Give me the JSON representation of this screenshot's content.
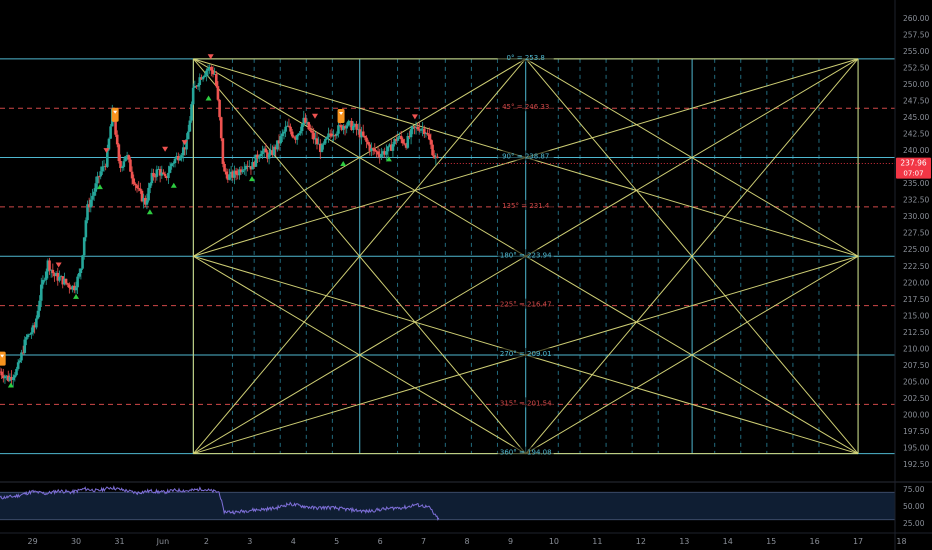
{
  "chart_data": {
    "type": "candlestick",
    "price_axis": {
      "range": [
        190.4,
        262.7
      ],
      "ticks": [
        "260.00",
        "257.50",
        "255.00",
        "252.50",
        "250.00",
        "247.50",
        "245.00",
        "242.50",
        "240.00",
        "237.50",
        "235.00",
        "232.50",
        "230.00",
        "227.50",
        "225.00",
        "222.50",
        "220.00",
        "217.50",
        "215.00",
        "212.50",
        "210.00",
        "207.50",
        "205.00",
        "202.50",
        "200.00",
        "197.50",
        "195.00",
        "192.50"
      ],
      "last_price": "237.96",
      "countdown": "07:07"
    },
    "time_axis": {
      "range": [
        28.15,
        18.75
      ],
      "labels": [
        {
          "t": 28.9,
          "label": "29"
        },
        {
          "t": 29.9,
          "label": "30"
        },
        {
          "t": 30.9,
          "label": "31"
        },
        {
          "t": 31.9,
          "label": "Jun"
        },
        {
          "t": 32.9,
          "label": "2"
        },
        {
          "t": 33.9,
          "label": "3"
        },
        {
          "t": 34.9,
          "label": "4"
        },
        {
          "t": 35.9,
          "label": "5"
        },
        {
          "t": 36.9,
          "label": "6"
        },
        {
          "t": 37.9,
          "label": "7"
        },
        {
          "t": 38.9,
          "label": "8"
        },
        {
          "t": 39.9,
          "label": "9"
        },
        {
          "t": 40.9,
          "label": "10"
        },
        {
          "t": 41.9,
          "label": "11"
        },
        {
          "t": 42.9,
          "label": "12"
        },
        {
          "t": 43.9,
          "label": "13"
        },
        {
          "t": 44.9,
          "label": "14"
        },
        {
          "t": 45.9,
          "label": "15"
        },
        {
          "t": 46.9,
          "label": "16"
        },
        {
          "t": 47.9,
          "label": "17"
        },
        {
          "t": 48.9,
          "label": "18"
        }
      ]
    },
    "price_path": [
      [
        28.15,
        206.5
      ],
      [
        28.35,
        205.4
      ],
      [
        28.55,
        206.8
      ],
      [
        28.75,
        211.5
      ],
      [
        28.95,
        213.2
      ],
      [
        29.1,
        219.0
      ],
      [
        29.25,
        223.0
      ],
      [
        29.4,
        221.0
      ],
      [
        29.55,
        220.5
      ],
      [
        29.7,
        219.7
      ],
      [
        29.85,
        219.2
      ],
      [
        30.0,
        221.5
      ],
      [
        30.15,
        231.0
      ],
      [
        30.3,
        233.5
      ],
      [
        30.45,
        236.5
      ],
      [
        30.6,
        238.3
      ],
      [
        30.75,
        246.5
      ],
      [
        30.9,
        237.0
      ],
      [
        31.05,
        239.5
      ],
      [
        31.2,
        236.0
      ],
      [
        31.35,
        233.5
      ],
      [
        31.5,
        232.0
      ],
      [
        31.65,
        236.0
      ],
      [
        31.8,
        237.0
      ],
      [
        31.95,
        235.5
      ],
      [
        32.1,
        238.0
      ],
      [
        32.3,
        239.5
      ],
      [
        32.45,
        241.0
      ],
      [
        32.6,
        249.0
      ],
      [
        32.75,
        251.0
      ],
      [
        32.95,
        252.5
      ],
      [
        33.1,
        251.5
      ],
      [
        33.2,
        245.0
      ],
      [
        33.3,
        236.5
      ],
      [
        33.45,
        236.0
      ],
      [
        33.6,
        236.5
      ],
      [
        33.8,
        238.0
      ],
      [
        33.95,
        237.5
      ],
      [
        34.15,
        240.0
      ],
      [
        34.35,
        239.0
      ],
      [
        34.55,
        241.0
      ],
      [
        34.75,
        243.5
      ],
      [
        34.95,
        242.0
      ],
      [
        35.15,
        244.5
      ],
      [
        35.35,
        242.0
      ],
      [
        35.55,
        240.0
      ],
      [
        35.75,
        242.5
      ],
      [
        35.9,
        243.0
      ],
      [
        36.1,
        244.0
      ],
      [
        36.3,
        243.5
      ],
      [
        36.5,
        242.0
      ],
      [
        36.7,
        240.0
      ],
      [
        36.9,
        239.5
      ],
      [
        37.1,
        240.0
      ],
      [
        37.3,
        242.0
      ],
      [
        37.5,
        241.0
      ],
      [
        37.65,
        243.0
      ],
      [
        37.8,
        243.5
      ],
      [
        37.95,
        243.0
      ],
      [
        38.05,
        241.0
      ],
      [
        38.15,
        239.0
      ],
      [
        38.25,
        237.96
      ]
    ],
    "gann_box": {
      "t_start": 32.6,
      "t_end": 47.9,
      "price_top": 253.8,
      "price_bottom": 194.08,
      "levels": [
        {
          "label": "0° = 253.8",
          "price": 253.8,
          "style": "solid",
          "color": "#4fb8d0"
        },
        {
          "label": "45° = 246.33",
          "price": 246.33,
          "style": "dashed",
          "color": "#d04848"
        },
        {
          "label": "90° = 238.87",
          "price": 238.87,
          "style": "solid",
          "color": "#4fb8d0"
        },
        {
          "label": "135° = 231.4",
          "price": 231.4,
          "style": "dashed",
          "color": "#d04848"
        },
        {
          "label": "180° = 223.94",
          "price": 223.94,
          "style": "solid",
          "color": "#4fb8d0"
        },
        {
          "label": "225° = 216.47",
          "price": 216.47,
          "style": "dashed",
          "color": "#d04848"
        },
        {
          "label": "270° = 209.01",
          "price": 209.01,
          "style": "solid",
          "color": "#4fb8d0"
        },
        {
          "label": "315° = 201.54",
          "price": 201.54,
          "style": "dashed",
          "color": "#d04848"
        },
        {
          "label": "360° = 194.08",
          "price": 194.08,
          "style": "solid",
          "color": "#4fb8d0"
        }
      ],
      "time_lines_solid": [
        32.6,
        36.43,
        40.25,
        44.08,
        47.9
      ],
      "time_lines_dashed": [
        33.5,
        34.0,
        34.6,
        35.2,
        35.8,
        37.3,
        37.8,
        38.4,
        39.0,
        39.6,
        41.0,
        41.5,
        42.1,
        42.7,
        43.3,
        44.6,
        45.2,
        45.8,
        46.4,
        47.0
      ]
    },
    "rsi": {
      "ticks": [
        "75.00",
        "50.00",
        "25.00"
      ],
      "upper": 70,
      "lower": 30,
      "range": [
        18,
        82
      ],
      "path": [
        [
          28.15,
          62
        ],
        [
          28.5,
          64
        ],
        [
          28.9,
          71
        ],
        [
          29.2,
          68
        ],
        [
          29.5,
          72
        ],
        [
          29.8,
          70
        ],
        [
          30.1,
          75
        ],
        [
          30.4,
          72
        ],
        [
          30.7,
          77
        ],
        [
          31.0,
          73
        ],
        [
          31.3,
          69
        ],
        [
          31.6,
          72
        ],
        [
          31.9,
          70
        ],
        [
          32.2,
          73
        ],
        [
          32.5,
          72
        ],
        [
          32.8,
          75
        ],
        [
          33.0,
          72
        ],
        [
          33.2,
          70
        ],
        [
          33.3,
          42
        ],
        [
          33.6,
          41
        ],
        [
          33.9,
          44
        ],
        [
          34.2,
          45
        ],
        [
          34.5,
          47
        ],
        [
          34.8,
          53
        ],
        [
          35.1,
          50
        ],
        [
          35.4,
          47
        ],
        [
          35.7,
          48
        ],
        [
          36.0,
          46
        ],
        [
          36.3,
          44
        ],
        [
          36.6,
          42
        ],
        [
          36.9,
          45
        ],
        [
          37.2,
          47
        ],
        [
          37.5,
          48
        ],
        [
          37.7,
          52
        ],
        [
          37.9,
          50
        ],
        [
          38.05,
          47
        ],
        [
          38.15,
          37
        ],
        [
          38.25,
          31
        ]
      ]
    },
    "signal_markers": [
      {
        "t": 28.2,
        "price": 208.3,
        "kind": "label"
      },
      {
        "t": 30.8,
        "price": 245.2,
        "kind": "label"
      },
      {
        "t": 36.0,
        "price": 245.0,
        "kind": "label"
      },
      {
        "t": 30.6,
        "price": 240.0,
        "kind": "down"
      },
      {
        "t": 31.95,
        "price": 240.2,
        "kind": "down"
      },
      {
        "t": 32.4,
        "price": 241.2,
        "kind": "down"
      },
      {
        "t": 33.0,
        "price": 254.2,
        "kind": "down"
      },
      {
        "t": 35.4,
        "price": 245.2,
        "kind": "down"
      },
      {
        "t": 37.7,
        "price": 245.1,
        "kind": "down"
      },
      {
        "t": 29.5,
        "price": 222.7,
        "kind": "down"
      },
      {
        "t": 28.4,
        "price": 204.4,
        "kind": "up"
      },
      {
        "t": 30.45,
        "price": 234.4,
        "kind": "up"
      },
      {
        "t": 29.9,
        "price": 217.8,
        "kind": "up"
      },
      {
        "t": 31.6,
        "price": 230.6,
        "kind": "up"
      },
      {
        "t": 32.15,
        "price": 234.6,
        "kind": "up"
      },
      {
        "t": 32.95,
        "price": 247.8,
        "kind": "up"
      },
      {
        "t": 33.95,
        "price": 235.6,
        "kind": "up"
      },
      {
        "t": 36.05,
        "price": 237.9,
        "kind": "up"
      },
      {
        "t": 37.1,
        "price": 238.6,
        "kind": "up"
      }
    ],
    "colors": {
      "bg": "#000000",
      "bull": "#26a69a",
      "bear": "#ef5350",
      "gann": "#d9d97a",
      "cyan": "#4fb8d0",
      "red_dash": "#d04848",
      "rsi_line": "#7e6fd8",
      "rsi_band": "#0f1e33",
      "axis_text": "#8a8f98",
      "price_tag": "#f23645",
      "signal_label": "#f7931e"
    }
  }
}
